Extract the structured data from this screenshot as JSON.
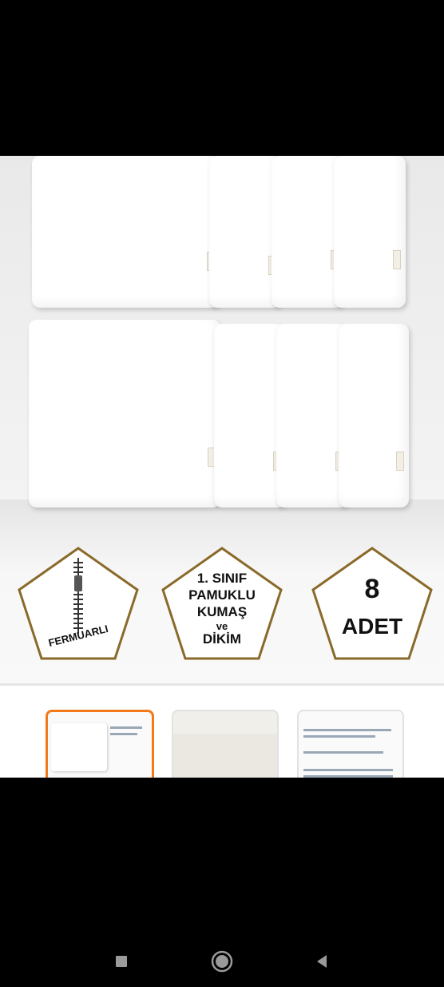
{
  "product": {
    "badges": [
      {
        "icon": "zipper-icon",
        "label": "FERMUARLI"
      },
      {
        "lines": [
          "1. SINIF",
          "PAMUKLU",
          "KUMAŞ",
          "ve",
          "DİKİM"
        ]
      },
      {
        "lines": [
          "8",
          "ADET"
        ]
      }
    ],
    "pillow_tag_icon": "label-tag-icon"
  },
  "gallery": {
    "thumbnails": [
      {
        "name": "thumb-1",
        "active": true
      },
      {
        "name": "thumb-2",
        "active": false
      },
      {
        "name": "thumb-3",
        "active": false
      }
    ]
  },
  "nav": {
    "items": [
      {
        "icon": "recents-icon"
      },
      {
        "icon": "home-icon"
      },
      {
        "icon": "back-icon"
      }
    ]
  },
  "colors": {
    "accent": "#f27a1a",
    "badge_border": "#8a6a2a",
    "badge_text": "#111111"
  }
}
